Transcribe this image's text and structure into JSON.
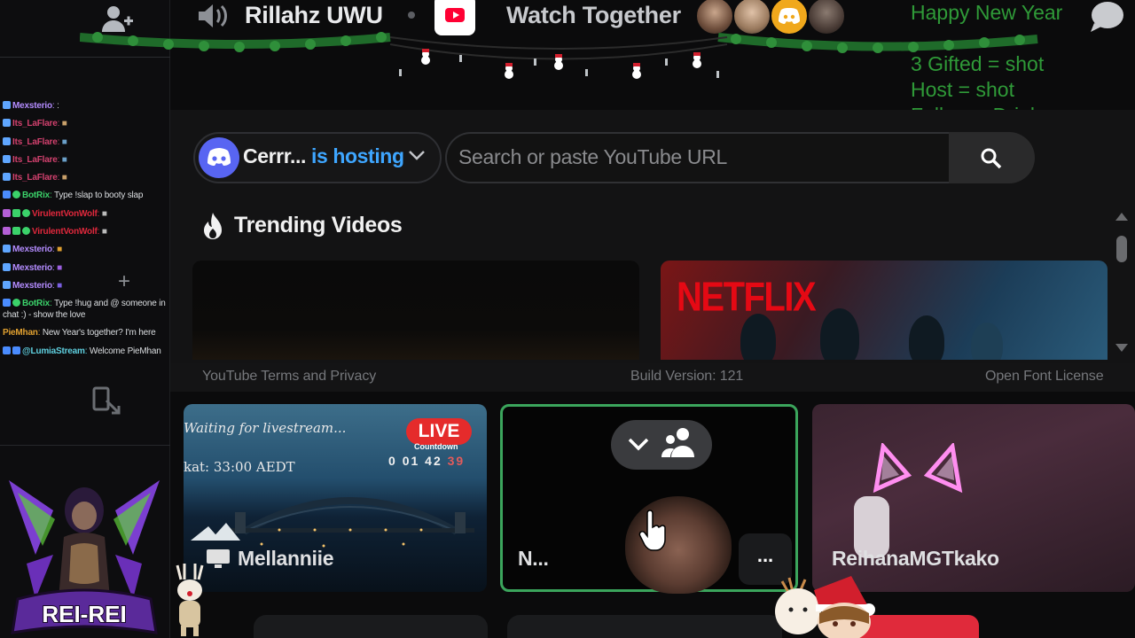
{
  "topbar": {
    "channel_name": "Rillahz UWU",
    "activity_name": "Watch Together"
  },
  "overlay": {
    "title": "Happy New Year",
    "lines": [
      "3 Gifted = shot",
      "Host = shot",
      "Follow = Drink"
    ]
  },
  "chat": {
    "messages": [
      {
        "user": "Mexsterio",
        "text": ":",
        "color": "#b48cff"
      },
      {
        "user": "Its_LaFlare",
        "text": "",
        "color": "#d2416e"
      },
      {
        "user": "Its_LaFlare",
        "text": "",
        "color": "#d2416e"
      },
      {
        "user": "Its_LaFlare",
        "text": "",
        "color": "#d2416e"
      },
      {
        "user": "Its_LaFlare",
        "text": "",
        "color": "#d2416e"
      },
      {
        "user": "BotRix",
        "text": "Type !slap to booty slap",
        "color": "#3bd26a"
      },
      {
        "user": "VirulentVonWolf",
        "text": "",
        "color": "#e0283c"
      },
      {
        "user": "VirulentVonWolf",
        "text": "",
        "color": "#e0283c"
      },
      {
        "user": "Mexsterio",
        "text": "",
        "color": "#b48cff"
      },
      {
        "user": "Mexsterio",
        "text": "",
        "color": "#b48cff"
      },
      {
        "user": "Mexsterio",
        "text": "",
        "color": "#b48cff"
      },
      {
        "user": "BotRix",
        "text": "Type !hug and @ someone in chat :) - show the love",
        "color": "#3bd26a"
      },
      {
        "user": "PieMhan",
        "text": "New Year's together? I'm here",
        "color": "#e0a030"
      },
      {
        "user": "@LumiaStream",
        "text": "Welcome PieMhan",
        "color": "#5fd0e0"
      }
    ]
  },
  "activity": {
    "host_name": "Cerrr...",
    "host_status": "is hosting",
    "search_placeholder": "Search or paste YouTube URL",
    "trending_title": "Trending Videos",
    "netflix_text": "NETFLIX",
    "footer": {
      "terms": "YouTube Terms and Privacy",
      "build": "Build Version: 121",
      "license": "Open Font License"
    }
  },
  "tiles": [
    {
      "name": "Mellanniie",
      "live_label": "LIVE",
      "overlay_line1": "Waiting for livestream...",
      "overlay_line2": "kat: 33:00 AEDT",
      "countdown_label": "Countdown",
      "countdown": [
        "0",
        "01",
        "42"
      ],
      "countdown_sec": "39"
    },
    {
      "name": "N...",
      "speaking": true,
      "menu": "..."
    },
    {
      "name": "ReihanaMGTkako"
    }
  ],
  "decorations": {
    "logo_text": "REI-REI"
  },
  "colors": {
    "accent_discord": "#5865f2",
    "hosting_blue": "#3ea6ff",
    "speaking_green": "#3ba55c",
    "overlay_green": "#2f9a38",
    "live_red": "#e52b2b"
  }
}
